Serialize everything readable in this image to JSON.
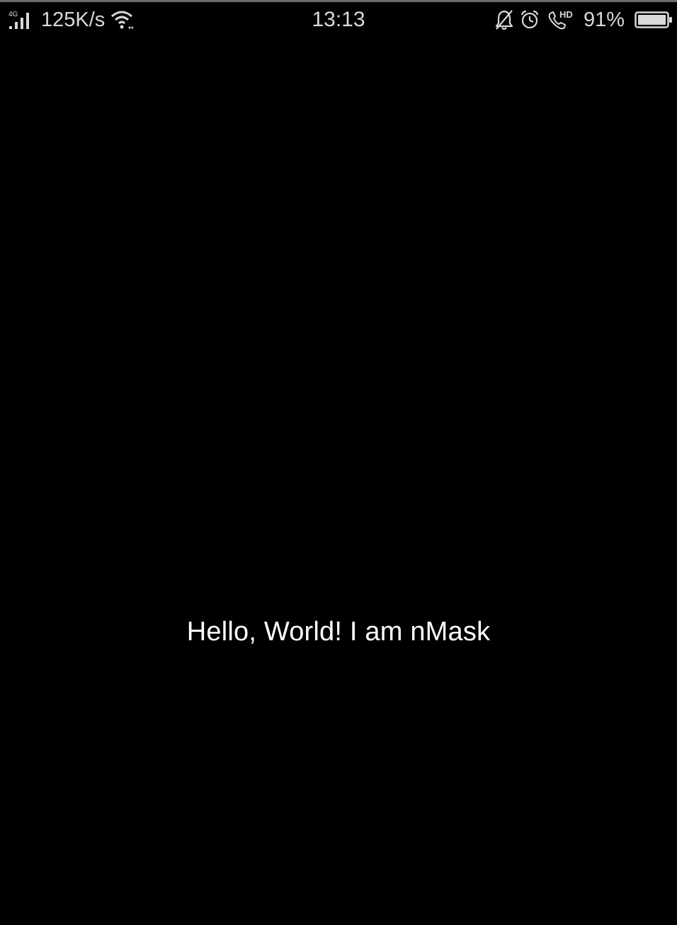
{
  "status_bar": {
    "network_type": "4G",
    "data_speed": "125K/s",
    "time": "13:13",
    "call_badge": "HD",
    "battery_percent": "91%",
    "battery_level": 0.91,
    "icons": {
      "signal": "signal-icon",
      "wifi": "wifi-icon",
      "mute": "bell-off-icon",
      "alarm": "alarm-icon",
      "call": "hd-call-icon",
      "battery": "battery-icon"
    }
  },
  "main": {
    "message": "Hello, World! I am nMask"
  },
  "colors": {
    "background": "#000000",
    "text": "#ffffff",
    "status_text": "#d8d8d8"
  }
}
